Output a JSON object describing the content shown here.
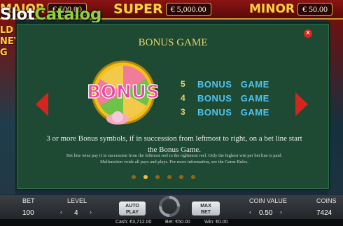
{
  "jackpots": {
    "major": {
      "label": "MAJOR",
      "value": "€ 500.00"
    },
    "super": {
      "label": "SUPER",
      "value": "€ 5,000.00"
    },
    "minor": {
      "label": "MINOR",
      "value": "€ 50.00"
    }
  },
  "watermark": {
    "slot": "Slot",
    "catalog": "Catalog"
  },
  "game_title_partial": [
    "LD",
    "NEY",
    "G"
  ],
  "paytable": {
    "title": "BONUS GAME",
    "symbol_text": "BONUS",
    "rows": [
      {
        "count": "5",
        "name": "BONUS   GAME"
      },
      {
        "count": "4",
        "name": "BONUS   GAME"
      },
      {
        "count": "3",
        "name": "BONUS   GAME"
      }
    ],
    "description": "3 or more Bonus symbols, if in succession from leftmost to right, on a bet line start the Bonus Game.",
    "fine_print": "Bet line wins pay if in succession from the leftmost reel to the rightmost reel. Only the highest win per bet line is paid. Malfunction voids all pays and plays. For more information, see the Game Rules.",
    "page_count": 6,
    "active_page": 2,
    "close_symbol": "×"
  },
  "controls": {
    "bet_label": "BET",
    "bet_value": "100",
    "level_label": "LEVEL",
    "level_value": "4",
    "autoplay_label_1": "AUTO",
    "autoplay_label_2": "PLAY",
    "maxbet_label_1": "MAX",
    "maxbet_label_2": "BET",
    "coin_value_label": "COIN VALUE",
    "coin_value": "0.50",
    "coins_label": "COINS",
    "coins_value": "7424"
  },
  "status": {
    "cash": "Cash: €3,712.00",
    "bet": "Bet: €50.00",
    "win": "Win: €0.00"
  },
  "colors": {
    "panel": "#1e4a33",
    "title": "#e8d46a",
    "bonus_text": "#4fc3f0",
    "arrow": "#d3261f",
    "accent_gold": "#ffd23f"
  }
}
